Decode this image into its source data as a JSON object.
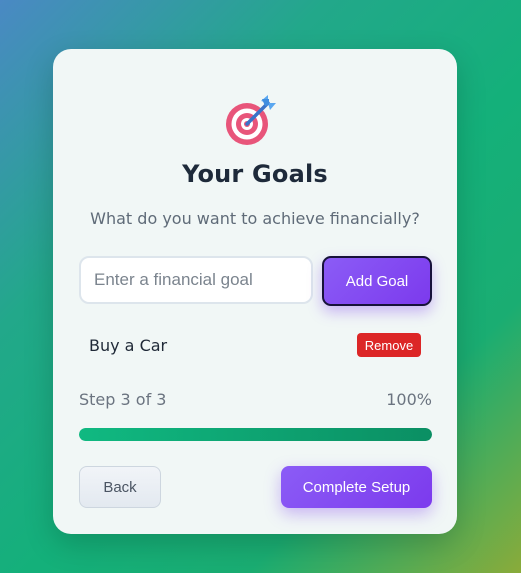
{
  "header": {
    "icon": "target-dart-icon",
    "title": "Your Goals",
    "subtitle": "What do you want to achieve financially?"
  },
  "goal_form": {
    "input_value": "",
    "input_placeholder": "Enter a financial goal",
    "add_label": "Add Goal"
  },
  "goals": [
    {
      "label": "Buy a Car",
      "remove_label": "Remove"
    }
  ],
  "progress": {
    "step_text": "Step 3 of 3",
    "percent_text": "100%",
    "fraction": 1.0
  },
  "nav": {
    "back_label": "Back",
    "complete_label": "Complete Setup"
  },
  "colors": {
    "accent": "#7c3aed",
    "progress": "#10b981",
    "danger": "#dc2626",
    "title": "#1e2a3a"
  }
}
